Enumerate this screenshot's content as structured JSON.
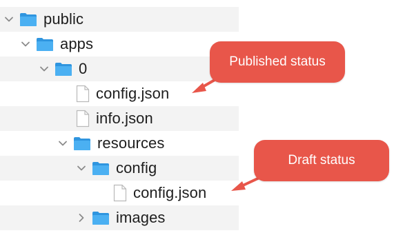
{
  "tree": {
    "rows": [
      {
        "label": "public",
        "kind": "folder",
        "expanded": true,
        "depth": 0
      },
      {
        "label": "apps",
        "kind": "folder",
        "expanded": true,
        "depth": 1
      },
      {
        "label": "0",
        "kind": "folder",
        "expanded": true,
        "depth": 2
      },
      {
        "label": "config.json",
        "kind": "file",
        "depth": 3
      },
      {
        "label": "info.json",
        "kind": "file",
        "depth": 3
      },
      {
        "label": "resources",
        "kind": "folder",
        "expanded": true,
        "depth": 3
      },
      {
        "label": "config",
        "kind": "folder",
        "expanded": true,
        "depth": 4
      },
      {
        "label": "config.json",
        "kind": "file",
        "depth": 5
      },
      {
        "label": "images",
        "kind": "folder",
        "expanded": false,
        "depth": 4
      }
    ]
  },
  "callouts": {
    "published": "Published status",
    "draft": "Draft status"
  },
  "colors": {
    "callout": "#e8564a",
    "folder": "#3ea9f0",
    "row_alt": "#f3f3f3"
  }
}
